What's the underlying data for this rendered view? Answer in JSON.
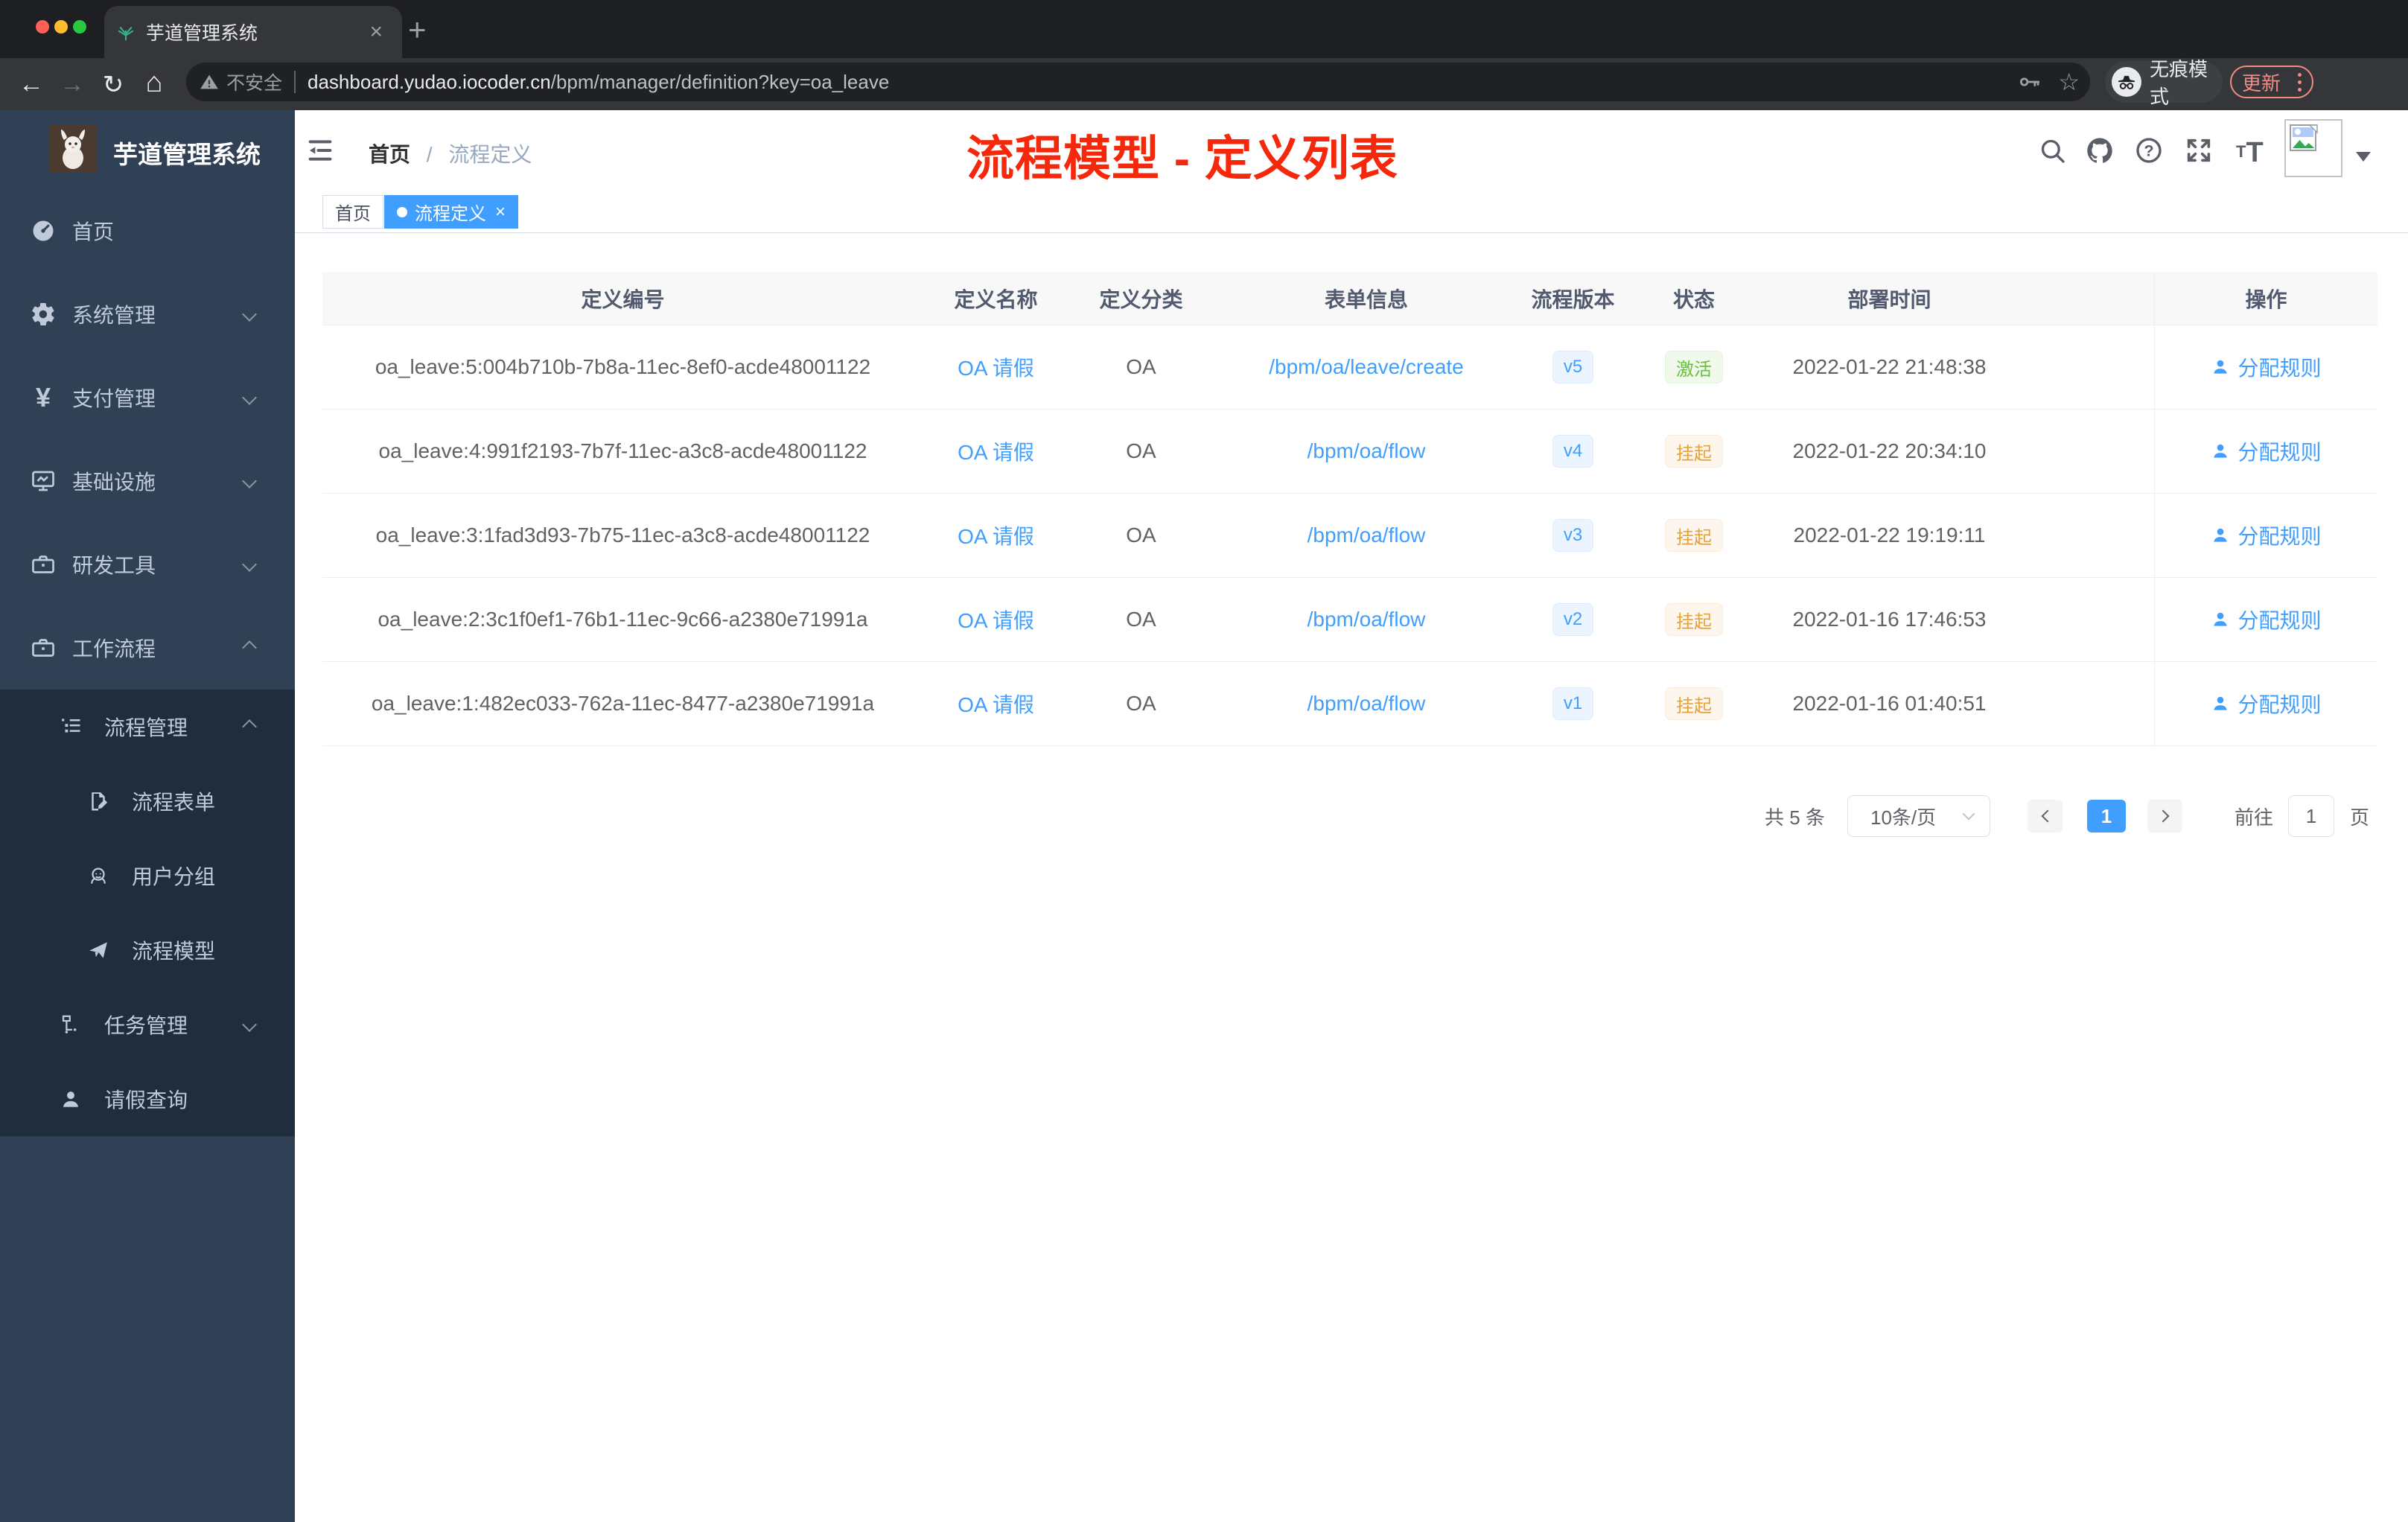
{
  "browser": {
    "tab_title": "芋道管理系统",
    "close_tab": "×",
    "new_tab": "+",
    "back": "←",
    "forward": "→",
    "reload": "↻",
    "home": "⌂",
    "security_label": "不安全",
    "url_domain": "dashboard.yudao.iocoder.cn",
    "url_path": "/bpm/manager/definition?key=oa_leave",
    "bookmark_star": "☆",
    "incognito_label": "无痕模式",
    "update_label": "更新"
  },
  "sidebar": {
    "title": "芋道管理系统",
    "menu": [
      {
        "label": "首页"
      },
      {
        "label": "系统管理"
      },
      {
        "label": "支付管理"
      },
      {
        "label": "基础设施"
      },
      {
        "label": "研发工具"
      },
      {
        "label": "工作流程"
      },
      {
        "label": "流程管理"
      },
      {
        "label": "流程表单"
      },
      {
        "label": "用户分组"
      },
      {
        "label": "流程模型"
      },
      {
        "label": "任务管理"
      },
      {
        "label": "请假查询"
      }
    ]
  },
  "navbar": {
    "breadcrumb_home": "首页",
    "breadcrumb_sep": "/",
    "breadcrumb_current": "流程定义"
  },
  "annotation": {
    "text": "流程模型 - 定义列表"
  },
  "tags": {
    "home": "首页",
    "active": "流程定义",
    "close": "×"
  },
  "table": {
    "columns": [
      "定义编号",
      "定义名称",
      "定义分类",
      "表单信息",
      "流程版本",
      "状态",
      "部署时间",
      "操作"
    ],
    "action_label": "分配规则",
    "rows": [
      {
        "id": "oa_leave:5:004b710b-7b8a-11ec-8ef0-acde48001122",
        "name": "OA 请假",
        "category": "OA",
        "form": "/bpm/oa/leave/create",
        "version": "v5",
        "status": "激活",
        "time": "2022-01-22 21:48:38"
      },
      {
        "id": "oa_leave:4:991f2193-7b7f-11ec-a3c8-acde48001122",
        "name": "OA 请假",
        "category": "OA",
        "form": "/bpm/oa/flow",
        "version": "v4",
        "status": "挂起",
        "time": "2022-01-22 20:34:10"
      },
      {
        "id": "oa_leave:3:1fad3d93-7b75-11ec-a3c8-acde48001122",
        "name": "OA 请假",
        "category": "OA",
        "form": "/bpm/oa/flow",
        "version": "v3",
        "status": "挂起",
        "time": "2022-01-22 19:19:11"
      },
      {
        "id": "oa_leave:2:3c1f0ef1-76b1-11ec-9c66-a2380e71991a",
        "name": "OA 请假",
        "category": "OA",
        "form": "/bpm/oa/flow",
        "version": "v2",
        "status": "挂起",
        "time": "2022-01-16 17:46:53"
      },
      {
        "id": "oa_leave:1:482ec033-762a-11ec-8477-a2380e71991a",
        "name": "OA 请假",
        "category": "OA",
        "form": "/bpm/oa/flow",
        "version": "v1",
        "status": "挂起",
        "time": "2022-01-16 01:40:51"
      }
    ]
  },
  "pagination": {
    "total": "共 5 条",
    "page_size": "10条/页",
    "page": "1",
    "goto_label": "前往",
    "goto_value": "1",
    "unit": "页"
  },
  "colors": {
    "accent": "#409eff",
    "success": "#67c23a",
    "warning": "#e6a23c",
    "sidebar_bg": "#304156",
    "submenu_bg": "#1f2d3d",
    "annotation_red": "#f5280c"
  }
}
